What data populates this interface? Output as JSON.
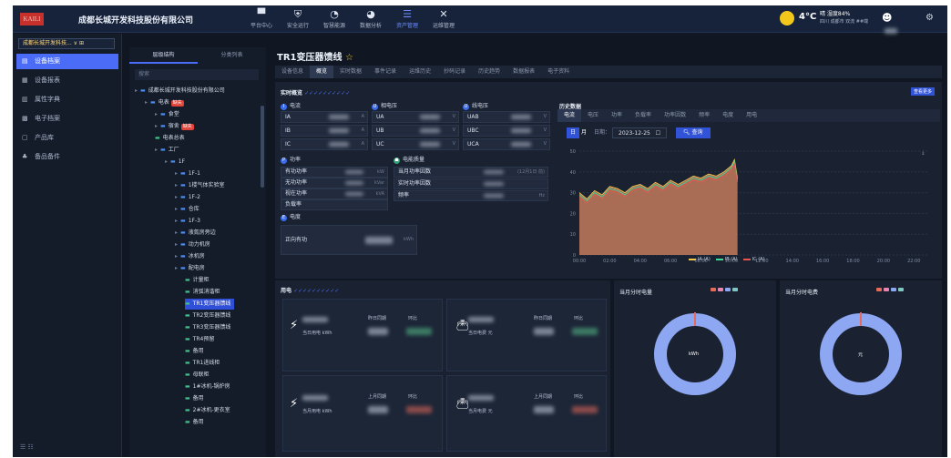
{
  "header": {
    "logo_text": "KAILI",
    "company": "成都长城开发科技股份有限公司",
    "nav": [
      {
        "label": "平台中心",
        "icon": "monitor-icon"
      },
      {
        "label": "安全运行",
        "icon": "shield-icon"
      },
      {
        "label": "智慧能源",
        "icon": "gauge-icon"
      },
      {
        "label": "数据分析",
        "icon": "pie-icon"
      },
      {
        "label": "资产管理",
        "icon": "database-icon",
        "active": true
      },
      {
        "label": "运维管理",
        "icon": "tools-icon"
      }
    ],
    "temperature": "4°C",
    "weather": "晴 湿度84%",
    "location": "四川 成都市 双流 ##端"
  },
  "sidebar": {
    "org": "成都长城开发科技...",
    "items": [
      {
        "label": "设备档案",
        "active": true
      },
      {
        "label": "设备报表"
      },
      {
        "label": "属性字典"
      },
      {
        "label": "电子档案"
      },
      {
        "label": "产品库"
      },
      {
        "label": "备品备件"
      }
    ]
  },
  "tree": {
    "tabs": [
      "层级结构",
      "分类列表"
    ],
    "search_placeholder": "搜索",
    "nodes": [
      {
        "label": "成都长城开发科技股份有限公司",
        "level": 0,
        "type": "folder",
        "badge": ""
      },
      {
        "label": "电表",
        "level": 1,
        "type": "folder",
        "badge": "缺失"
      },
      {
        "label": "食堂",
        "level": 2,
        "type": "folder",
        "badge": ""
      },
      {
        "label": "宿舍",
        "level": 2,
        "type": "folder",
        "badge": "缺失"
      },
      {
        "label": "电表总表",
        "level": 2,
        "type": "leaf",
        "badge": ""
      },
      {
        "label": "工厂",
        "level": 2,
        "type": "folder",
        "badge": ""
      },
      {
        "label": "1F",
        "level": 3,
        "type": "folder",
        "badge": ""
      },
      {
        "label": "1F-1",
        "level": 4,
        "type": "folder",
        "badge": ""
      },
      {
        "label": "1楼气体实验室",
        "level": 4,
        "type": "folder",
        "badge": ""
      },
      {
        "label": "1F-2",
        "level": 4,
        "type": "folder",
        "badge": ""
      },
      {
        "label": "仓库",
        "level": 4,
        "type": "folder",
        "badge": ""
      },
      {
        "label": "1F-3",
        "level": 4,
        "type": "folder",
        "badge": ""
      },
      {
        "label": "液氮房旁边",
        "level": 4,
        "type": "folder",
        "badge": ""
      },
      {
        "label": "动力机房",
        "level": 4,
        "type": "folder",
        "badge": ""
      },
      {
        "label": "冰机房",
        "level": 4,
        "type": "folder",
        "badge": ""
      },
      {
        "label": "配电房",
        "level": 4,
        "type": "folder",
        "badge": ""
      },
      {
        "label": "计量柜",
        "level": 5,
        "type": "leaf",
        "badge": ""
      },
      {
        "label": "消弧消谐柜",
        "level": 5,
        "type": "leaf",
        "badge": ""
      },
      {
        "label": "TR1变压器馈线",
        "level": 5,
        "type": "leaf",
        "badge": "",
        "selected": true
      },
      {
        "label": "TR2变压器馈线",
        "level": 5,
        "type": "leaf",
        "badge": ""
      },
      {
        "label": "TR3变压器馈线",
        "level": 5,
        "type": "leaf",
        "badge": ""
      },
      {
        "label": "TR4预留",
        "level": 5,
        "type": "leaf",
        "badge": ""
      },
      {
        "label": "备用",
        "level": 5,
        "type": "leaf",
        "badge": ""
      },
      {
        "label": "TR1进线柜",
        "level": 5,
        "type": "leaf",
        "badge": ""
      },
      {
        "label": "母联柜",
        "level": 5,
        "type": "leaf",
        "badge": ""
      },
      {
        "label": "1#冰机-锅炉房",
        "level": 5,
        "type": "leaf",
        "badge": ""
      },
      {
        "label": "备用",
        "level": 5,
        "type": "leaf",
        "badge": ""
      },
      {
        "label": "2#冰机-更衣室",
        "level": 5,
        "type": "leaf",
        "badge": ""
      },
      {
        "label": "备用",
        "level": 5,
        "type": "leaf",
        "badge": ""
      }
    ]
  },
  "main": {
    "title": "TR1变压器馈线",
    "tabs": [
      {
        "label": "设备信息"
      },
      {
        "label": "概览",
        "active": true
      },
      {
        "label": "实时数据"
      },
      {
        "label": "事件记录"
      },
      {
        "label": "运维历史"
      },
      {
        "label": "抄码记录"
      },
      {
        "label": "历史趋势"
      },
      {
        "label": "数据报表"
      },
      {
        "label": "电子资料"
      }
    ],
    "realtime": {
      "title": "实时概览",
      "more_label": "查看更多",
      "current_label": "电流",
      "phase_voltage_label": "相电压",
      "line_voltage_label": "线电压",
      "rows": [
        {
          "c": "IA",
          "cu": "A",
          "v": "UA",
          "vu": "V",
          "l": "UAB",
          "lu": "V"
        },
        {
          "c": "IB",
          "cu": "A",
          "v": "UB",
          "vu": "V",
          "l": "UBC",
          "lu": "V"
        },
        {
          "c": "IC",
          "cu": "A",
          "v": "UC",
          "vu": "V",
          "l": "UCA",
          "lu": "V"
        }
      ],
      "power_label": "功率",
      "power_rows": [
        {
          "label": "有功功率",
          "unit": "kW"
        },
        {
          "label": "无功功率",
          "unit": "kVar"
        },
        {
          "label": "视在功率",
          "unit": "kVA"
        },
        {
          "label": "负载率",
          "unit": ""
        }
      ],
      "quality_label": "电能质量",
      "quality_rows": [
        {
          "label": "当月功率因数",
          "value": "(12月1日 前)"
        },
        {
          "label": "实时功率因数",
          "value": ""
        },
        {
          "label": "频率",
          "value": "Hz"
        }
      ],
      "energy_label": "电度",
      "energy_row": {
        "label": "正向有功",
        "unit": "kWh"
      }
    },
    "history": {
      "title": "历史数据",
      "tabs": [
        "电流",
        "电压",
        "功率",
        "负载率",
        "功率因数",
        "频率",
        "电度",
        "用电"
      ],
      "day_btn": "日",
      "month_btn": "月",
      "date_label": "日期：",
      "date_value": "2023-12-25",
      "query_btn": "查询"
    },
    "usage": {
      "title": "用电",
      "today_kwh_label": "当日用电 kWh",
      "today_cost_label": "当日电费 元",
      "month_kwh_label": "当月用电 kWh",
      "month_cost_label": "当月电费 元",
      "yesterday_same": "昨日同期",
      "lastmonth_same": "上月同期",
      "ratio_label": "环比",
      "donut1_title": "当月分时电量",
      "donut1_center": "kWh",
      "donut2_title": "当月分时电费",
      "donut2_center": "元"
    }
  },
  "chart_data": {
    "type": "area",
    "title": "",
    "x": [
      "00:00",
      "02:00",
      "04:00",
      "06:00",
      "08:00",
      "10:00",
      "12:00",
      "14:00",
      "16:00",
      "18:00",
      "20:00",
      "22:00"
    ],
    "ylim": [
      0,
      50
    ],
    "yticks": [
      0,
      10,
      20,
      30,
      40,
      50
    ],
    "x_hours_range": [
      0,
      23
    ],
    "series": [
      {
        "name": "IA (A)",
        "color": "#f2c94c",
        "hours": [
          0,
          0.5,
          1,
          1.5,
          2,
          2.5,
          3,
          3.5,
          4,
          4.5,
          5,
          5.5,
          6,
          6.5,
          7,
          7.5,
          8,
          8.5,
          9,
          9.5,
          10,
          10.2,
          10.4
        ],
        "values": [
          30,
          27,
          31,
          29,
          33,
          32,
          30,
          33,
          34,
          32,
          35,
          33,
          36,
          34,
          36,
          38,
          37,
          39,
          38,
          40,
          43,
          46,
          37
        ]
      },
      {
        "name": "IB (A)",
        "color": "#3ddc97",
        "hours": [
          0,
          0.5,
          1,
          1.5,
          2,
          2.5,
          3,
          3.5,
          4,
          4.5,
          5,
          5.5,
          6,
          6.5,
          7,
          7.5,
          8,
          8.5,
          9,
          9.5,
          10,
          10.2,
          10.4
        ],
        "values": [
          29,
          26,
          30,
          28,
          32,
          31,
          29,
          32,
          33,
          31,
          34,
          32,
          35,
          33,
          35,
          37,
          36,
          38,
          37,
          39,
          42,
          45,
          36
        ]
      },
      {
        "name": "IC (A)",
        "color": "#e8574f",
        "hours": [
          0,
          0.5,
          1,
          1.5,
          2,
          2.5,
          3,
          3.5,
          4,
          4.5,
          5,
          5.5,
          6,
          6.5,
          7,
          7.5,
          8,
          8.5,
          9,
          9.5,
          10,
          10.2,
          10.4
        ],
        "values": [
          28,
          25,
          29,
          27,
          31,
          30,
          28,
          31,
          32,
          30,
          33,
          31,
          34,
          32,
          34,
          36,
          35,
          37,
          36,
          38,
          41,
          44,
          35
        ]
      }
    ],
    "grid": true,
    "legend": "bottom"
  },
  "donut_colors": {
    "main": "#8ea7f3",
    "accent": "#e66a5a"
  }
}
